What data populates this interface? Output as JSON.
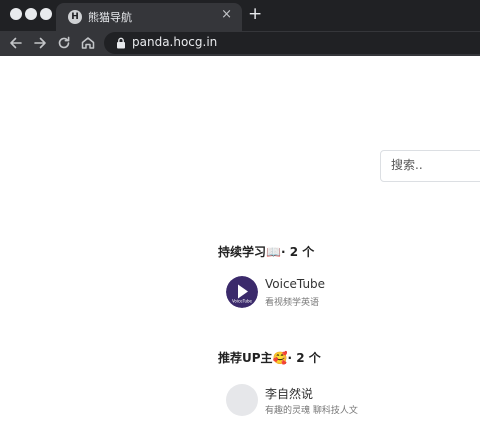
{
  "browser": {
    "tab_title": "熊猫导航",
    "tab_close": "×",
    "new_tab": "+",
    "url": "panda.hocg.in"
  },
  "search": {
    "placeholder": "搜索.."
  },
  "sections": [
    {
      "title": "持续学习📖·",
      "count": "2 个",
      "items": [
        {
          "name": "VoiceTube",
          "description": "看视频学英语",
          "logo_text": "VoiceTube",
          "logo_color": "#3b2a6b"
        }
      ]
    },
    {
      "title": "推荐UP主🥰·",
      "count": "2 个",
      "items": [
        {
          "name": "李自然说",
          "description": "有趣的灵魂 聊科技人文",
          "logo_color": "#e6e7ea"
        }
      ]
    }
  ]
}
